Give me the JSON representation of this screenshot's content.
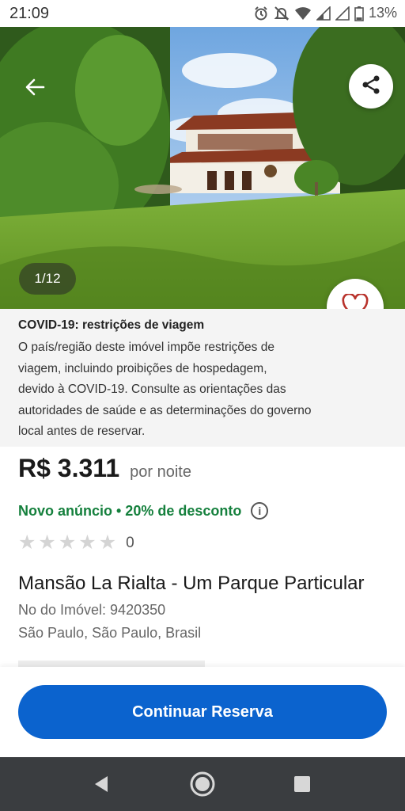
{
  "status_bar": {
    "time": "21:09",
    "battery": "13%",
    "icons": [
      "alarm-icon",
      "mute-icon",
      "wifi-icon",
      "signal-icon",
      "signal-icon",
      "battery-icon"
    ]
  },
  "hero": {
    "counter": "1/12",
    "icons": {
      "back": "arrow-left-icon",
      "share": "share-icon",
      "favorite": "heart-icon"
    }
  },
  "covid": {
    "title": "COVID-19: restrições de viagem",
    "lines": [
      "O país/região deste imóvel impõe restrições de",
      "viagem, incluindo proibições de hospedagem,",
      "devido à COVID-19. Consulte as orientações das",
      "autoridades de saúde e as determinações do governo",
      "local antes de reservar."
    ]
  },
  "listing": {
    "price": "R$ 3.311",
    "price_unit": "por noite",
    "promo": "Novo anúncio • 20% de desconto",
    "rating_value": 0,
    "rating_max": 5,
    "review_count": "0",
    "title": "Mansão La Rialta - Um Parque Particular",
    "property_id": "No do Imóvel: 9420350",
    "location": "São Paulo, São Paulo, Brasil"
  },
  "cta": {
    "label": "Continuar Reserva"
  },
  "colors": {
    "accent": "#0b63ce",
    "promo": "#15803d",
    "heart": "#b8322b"
  },
  "nav": {
    "icons": [
      "back-triangle-icon",
      "home-circle-icon",
      "recents-square-icon"
    ]
  }
}
